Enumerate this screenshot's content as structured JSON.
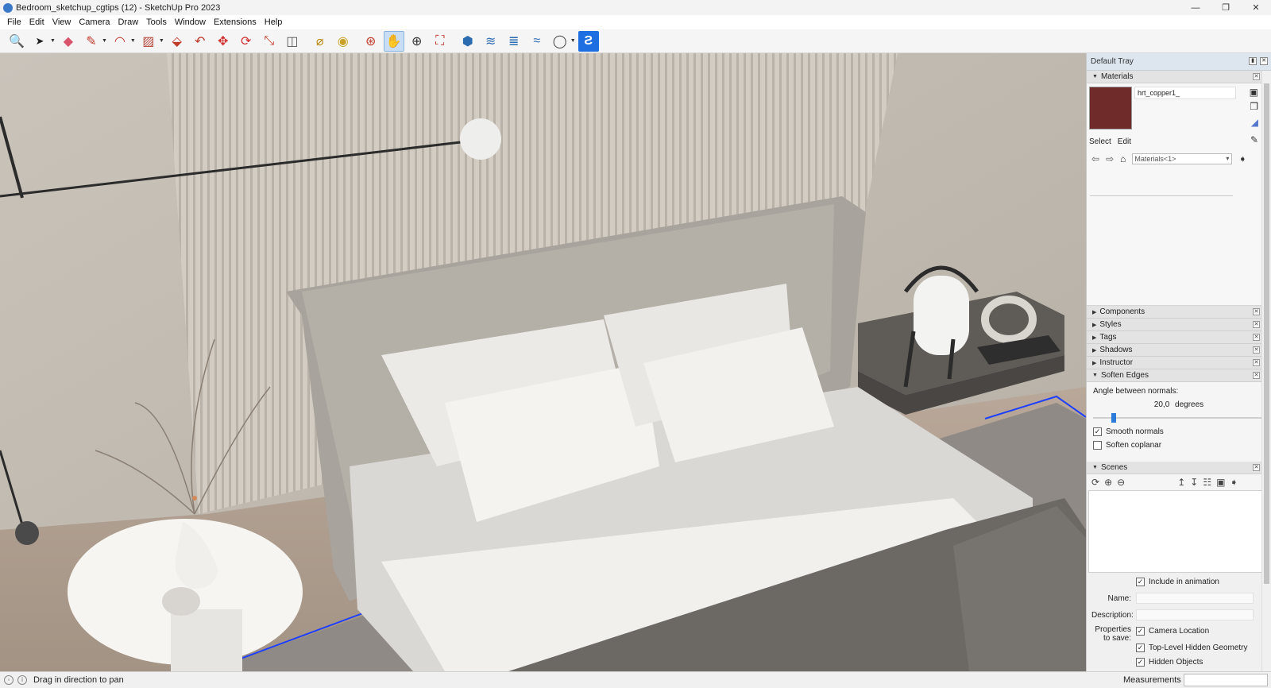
{
  "window": {
    "title": "Bedroom_sketchup_cgtips (12) - SketchUp Pro 2023",
    "controls": [
      "—",
      "❐",
      "✕"
    ]
  },
  "menu": [
    "File",
    "Edit",
    "View",
    "Camera",
    "Draw",
    "Tools",
    "Window",
    "Extensions",
    "Help"
  ],
  "toolbar": {
    "tools": [
      {
        "name": "search-icon",
        "glyph": "🔍"
      },
      {
        "name": "select-arrow-icon",
        "glyph": "➤"
      },
      {
        "name": "eraser-icon",
        "glyph": "◆"
      },
      {
        "name": "pencil-icon",
        "glyph": "✎"
      },
      {
        "name": "arc-icon",
        "glyph": "◠"
      },
      {
        "name": "rectangle-icon",
        "glyph": "▨"
      },
      {
        "name": "push-pull-icon",
        "glyph": "⬙"
      },
      {
        "name": "follow-me-icon",
        "glyph": "↶"
      },
      {
        "name": "move-icon",
        "glyph": "✥"
      },
      {
        "name": "rotate-icon",
        "glyph": "⟳"
      },
      {
        "name": "scale-icon",
        "glyph": "⤡"
      },
      {
        "name": "offset-icon",
        "glyph": "◫"
      },
      {
        "name": "tape-measure-icon",
        "glyph": "⌀"
      },
      {
        "name": "paint-bucket-icon",
        "glyph": "◉"
      },
      {
        "name": "orbit-icon",
        "glyph": "⊛"
      },
      {
        "name": "pan-hand-icon",
        "glyph": "✋"
      },
      {
        "name": "zoom-icon",
        "glyph": "⊕"
      },
      {
        "name": "zoom-extents-icon",
        "glyph": "⛶"
      },
      {
        "name": "warehouse-icon",
        "glyph": "⬢"
      },
      {
        "name": "extension-warehouse-icon",
        "glyph": "≋"
      },
      {
        "name": "layout-icon",
        "glyph": "≣"
      },
      {
        "name": "send-to-layout-icon",
        "glyph": "≈"
      },
      {
        "name": "user-account-icon",
        "glyph": "◯"
      },
      {
        "name": "sketchup-app-icon",
        "glyph": "Ƨ"
      }
    ],
    "active_tool": "pan-hand-icon"
  },
  "tray": {
    "title": "Default Tray",
    "materials": {
      "header": "Materials",
      "swatch_color": "#6f2a2a",
      "material_name": "hrt_copper1_",
      "tabs": [
        "Select",
        "Edit"
      ],
      "collection": "Materials<1>"
    },
    "collapsed_panels": [
      "Components",
      "Styles",
      "Tags",
      "Shadows",
      "Instructor"
    ],
    "soften_edges": {
      "header": "Soften Edges",
      "angle_label": "Angle between normals:",
      "angle_value": "20,0",
      "angle_unit": "degrees",
      "angle_slider_fraction": 0.11,
      "smooth_normals_label": "Smooth normals",
      "smooth_normals_checked": true,
      "soften_coplanar_label": "Soften coplanar",
      "soften_coplanar_checked": false
    },
    "scenes": {
      "header": "Scenes",
      "include_animation_label": "Include in animation",
      "include_animation_checked": true,
      "name_label": "Name:",
      "name_value": "",
      "description_label": "Description:",
      "description_value": "",
      "properties_label_1": "Properties",
      "properties_label_2": "to save:",
      "camera_location_label": "Camera Location",
      "top_level_hidden_label": "Top-Level Hidden Geometry",
      "hidden_objects_label": "Hidden Objects"
    }
  },
  "status": {
    "hint": "Drag in direction to pan",
    "measurements_label": "Measurements",
    "measurements_value": ""
  }
}
